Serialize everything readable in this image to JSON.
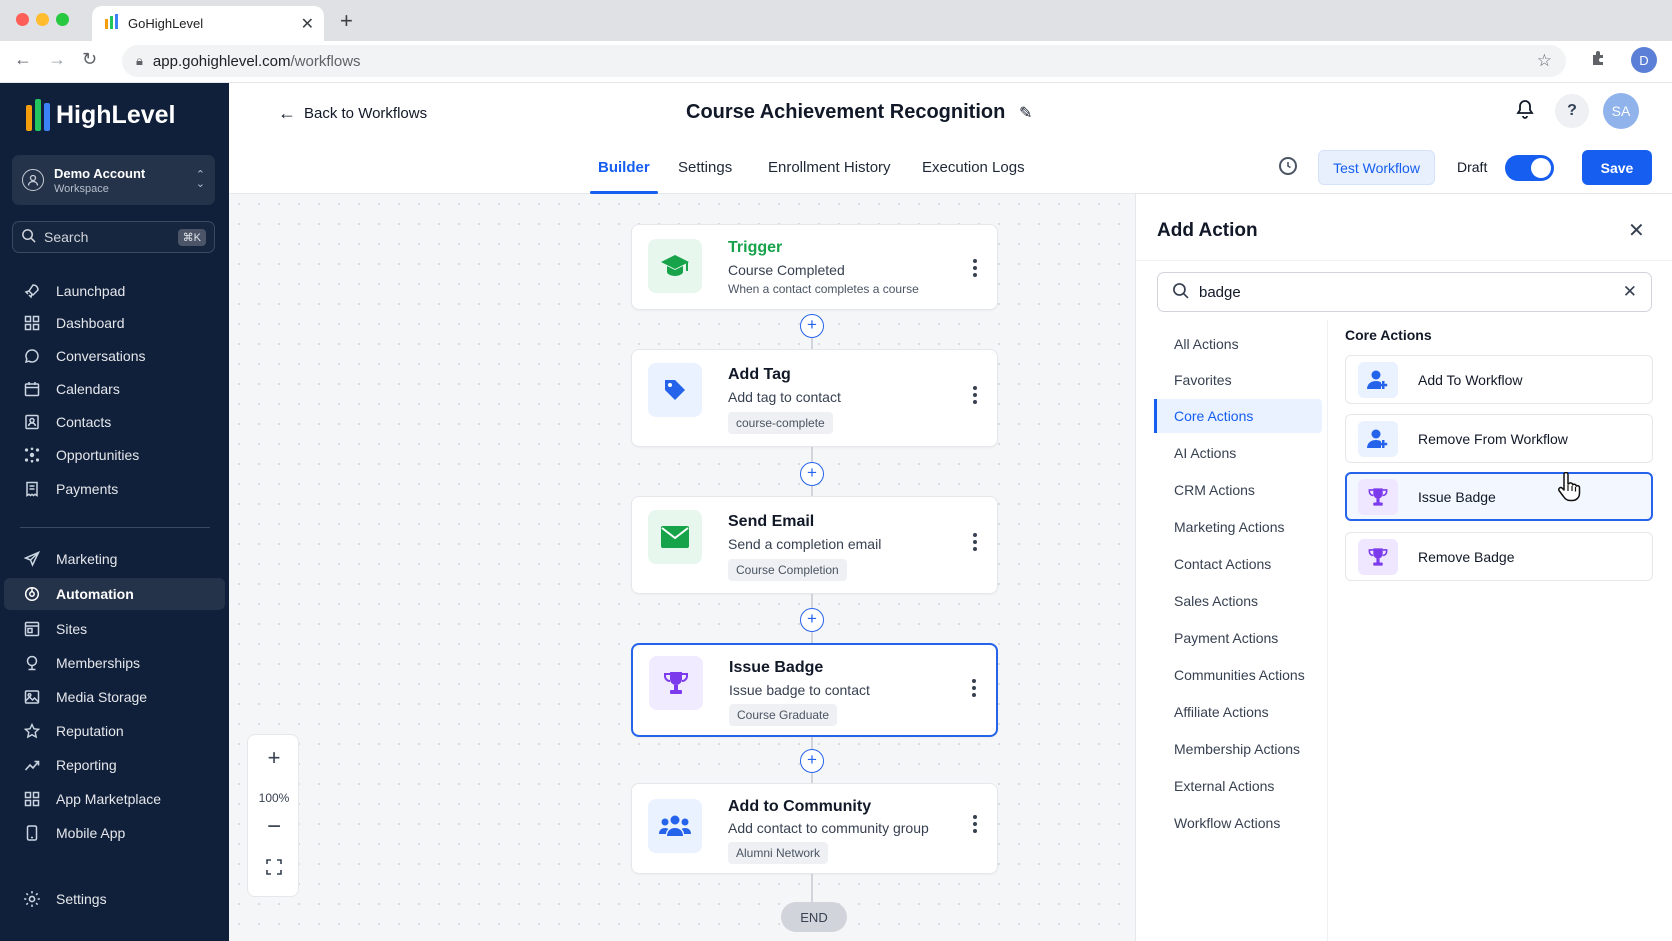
{
  "browser": {
    "tab_title": "GoHighLevel",
    "url_host": "app.gohighlevel.com",
    "url_path": "/workflows",
    "profile_initial": "D"
  },
  "sidebar": {
    "brand": "HighLevel",
    "account": {
      "name": "Demo Account",
      "type": "Workspace"
    },
    "search": {
      "placeholder": "Search",
      "shortcut": "⌘K"
    },
    "items": [
      {
        "label": "Launchpad",
        "icon": "rocket-icon"
      },
      {
        "label": "Dashboard",
        "icon": "grid-icon"
      },
      {
        "label": "Conversations",
        "icon": "chat-icon"
      },
      {
        "label": "Calendars",
        "icon": "calendar-icon"
      },
      {
        "label": "Contacts",
        "icon": "contacts-icon"
      },
      {
        "label": "Opportunities",
        "icon": "network-icon"
      },
      {
        "label": "Payments",
        "icon": "receipt-icon"
      },
      {
        "label": "Marketing",
        "icon": "send-icon"
      },
      {
        "label": "Automation",
        "icon": "automation-icon",
        "active": true
      },
      {
        "label": "Sites",
        "icon": "sites-icon"
      },
      {
        "label": "Memberships",
        "icon": "membership-icon"
      },
      {
        "label": "Media Storage",
        "icon": "image-icon"
      },
      {
        "label": "Reputation",
        "icon": "star-icon"
      },
      {
        "label": "Reporting",
        "icon": "trend-icon"
      },
      {
        "label": "App Marketplace",
        "icon": "apps-icon"
      },
      {
        "label": "Mobile App",
        "icon": "phone-icon"
      },
      {
        "label": "Settings",
        "icon": "gear-icon"
      }
    ]
  },
  "header": {
    "back_label": "Back to Workflows",
    "workflow_title": "Course Achievement Recognition",
    "user_initials": "SA"
  },
  "tabs": [
    {
      "label": "Builder",
      "active": true
    },
    {
      "label": "Settings"
    },
    {
      "label": "Enrollment History"
    },
    {
      "label": "Execution Logs"
    }
  ],
  "toolbar": {
    "test_label": "Test Workflow",
    "status_label": "Draft",
    "save_label": "Save"
  },
  "canvas": {
    "nodes": [
      {
        "kind": "trigger",
        "label": "Trigger",
        "title": "Course Completed",
        "desc": "When a contact completes a course",
        "icon": "graduation-cap-icon"
      },
      {
        "title": "Add Tag",
        "desc": "Add tag to contact",
        "chip": "course-complete",
        "icon": "tag-icon"
      },
      {
        "title": "Send Email",
        "desc": "Send a completion email",
        "chip": "Course Completion",
        "icon": "mail-icon"
      },
      {
        "title": "Issue Badge",
        "desc": "Issue badge to contact",
        "chip": "Course Graduate",
        "icon": "trophy-icon",
        "selected": true
      },
      {
        "title": "Add to Community",
        "desc": "Add contact to community group",
        "chip": "Alumni Network",
        "icon": "users-icon"
      }
    ],
    "end_label": "END",
    "zoom_level": "100%"
  },
  "panel": {
    "title": "Add Action",
    "search_value": "badge",
    "categories": [
      "All Actions",
      "Favorites",
      "Core Actions",
      "AI Actions",
      "CRM Actions",
      "Marketing Actions",
      "Contact Actions",
      "Sales Actions",
      "Payment Actions",
      "Communities Actions",
      "Affiliate Actions",
      "Membership Actions",
      "External Actions",
      "Workflow Actions"
    ],
    "active_category": "Core Actions",
    "section_heading": "Core Actions",
    "actions": [
      {
        "label": "Add To Workflow",
        "icon": "user-plus-icon"
      },
      {
        "label": "Remove From Workflow",
        "icon": "user-plus-icon"
      },
      {
        "label": "Issue Badge",
        "icon": "trophy-icon",
        "hovered": true
      },
      {
        "label": "Remove Badge",
        "icon": "trophy-icon"
      }
    ]
  },
  "colors": {
    "accent": "#155eef",
    "sidebar_bg": "#10203a",
    "trigger_green": "#16a34a",
    "badge_purple": "#7c3aed"
  }
}
